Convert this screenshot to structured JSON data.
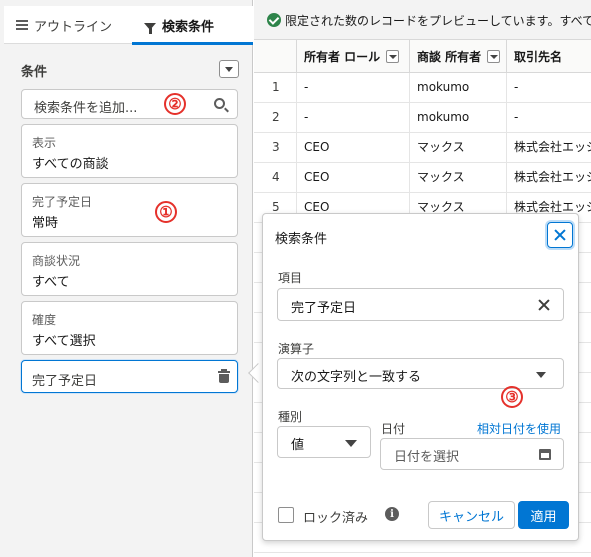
{
  "tabs": {
    "outline": "アウトライン",
    "filter": "検索条件"
  },
  "conditions": {
    "title": "条件",
    "search_placeholder": "検索条件を追加...",
    "cards": [
      {
        "label": "表示",
        "value": "すべての商談"
      },
      {
        "label": "完了予定日",
        "value": "常時"
      },
      {
        "label": "商談状況",
        "value": "すべて"
      },
      {
        "label": "確度",
        "value": "すべて選択"
      }
    ],
    "new_card_label": "完了予定日"
  },
  "annotations": {
    "one": "①",
    "two": "②",
    "three": "③"
  },
  "banner": {
    "text": "限定された数のレコードをプレビューしています。すべて"
  },
  "grid": {
    "columns": [
      "所有者 ロール",
      "商談 所有者",
      "取引先名"
    ],
    "rows": [
      {
        "n": "1",
        "role": "-",
        "owner": "mokumo",
        "account": "-"
      },
      {
        "n": "2",
        "role": "-",
        "owner": "mokumo",
        "account": "-"
      },
      {
        "n": "3",
        "role": "CEO",
        "owner": "マックス",
        "account": "株式会社エッジ"
      },
      {
        "n": "4",
        "role": "CEO",
        "owner": "マックス",
        "account": "株式会社エッジ"
      },
      {
        "n": "5",
        "role": "CEO",
        "owner": "マックス",
        "account": "株式会社エッジ"
      }
    ]
  },
  "popover": {
    "title": "検索条件",
    "field_label": "項目",
    "field_value": "完了予定日",
    "operator_label": "演算子",
    "operator_value": "次の文字列と一致する",
    "type_label": "種別",
    "type_value": "値",
    "date_label": "日付",
    "relative_link": "相対日付を使用",
    "date_placeholder": "日付を選択",
    "lock_label": "ロック済み",
    "info_glyph": "i",
    "cancel_label": "キャンセル",
    "apply_label": "適用"
  }
}
